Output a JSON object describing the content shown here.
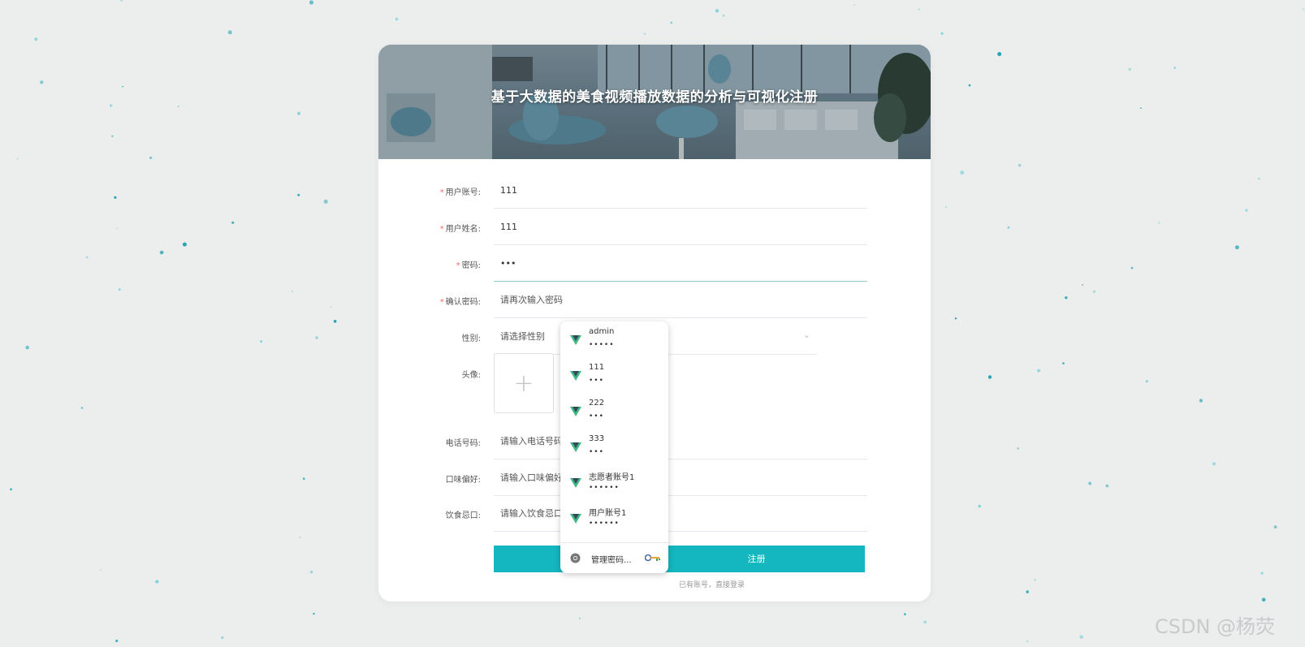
{
  "banner": {
    "title": "基于大数据的美食视频播放数据的分析与可视化注册"
  },
  "form": {
    "account": {
      "label": "用户账号:",
      "value": "111",
      "required": true
    },
    "name": {
      "label": "用户姓名:",
      "value": "111",
      "required": true
    },
    "password": {
      "label": "密码:",
      "value": "•••",
      "required": true
    },
    "confirm": {
      "label": "确认密码:",
      "placeholder": "请再次输入密码",
      "required": true
    },
    "gender": {
      "label": "性别:",
      "placeholder": "请选择性别"
    },
    "avatar": {
      "label": "头像:",
      "icon": "plus-icon"
    },
    "phone": {
      "label": "电话号码:",
      "placeholder": "请输入电话号码"
    },
    "taste": {
      "label": "口味偏好:",
      "placeholder": "请输入口味偏好"
    },
    "diet": {
      "label": "饮食忌口:",
      "placeholder": "请输入饮食忌口"
    },
    "submit_label": "注册",
    "login_link": "已有账号，直接登录"
  },
  "autofill": {
    "items": [
      {
        "user": "admin",
        "pass": "•••••"
      },
      {
        "user": "111",
        "pass": "•••"
      },
      {
        "user": "222",
        "pass": "•••"
      },
      {
        "user": "333",
        "pass": "•••"
      },
      {
        "user": "志愿者账号1",
        "pass": "••••••"
      },
      {
        "user": "用户账号1",
        "pass": "••••••"
      }
    ],
    "manage_label": "管理密码...",
    "icons": {
      "item": "vue-logo-icon",
      "browser": "chrome-icon",
      "key": "key-icon"
    }
  },
  "watermark": "CSDN @杨荧",
  "colors": {
    "accent": "#14b7bf",
    "required": "#f56c6c",
    "vue_green": "#42b883",
    "vue_dark": "#35495e"
  }
}
